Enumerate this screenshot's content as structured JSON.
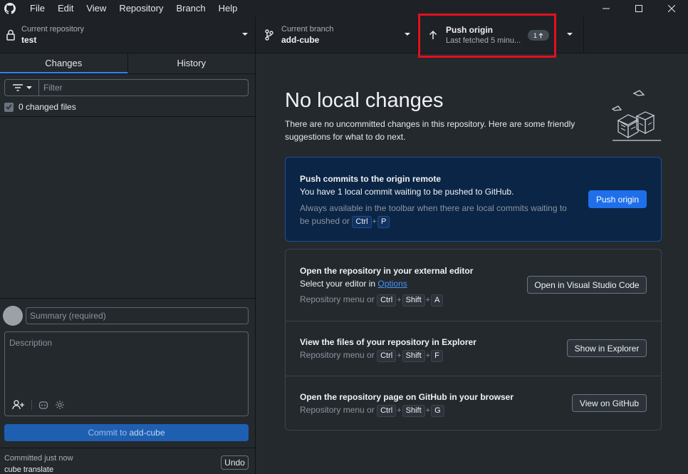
{
  "menu": [
    "File",
    "Edit",
    "View",
    "Repository",
    "Branch",
    "Help"
  ],
  "toolbar": {
    "repo_label": "Current repository",
    "repo_name": "test",
    "branch_label": "Current branch",
    "branch_name": "add-cube",
    "push_title": "Push origin",
    "push_sub": "Last fetched 5 minu...",
    "push_count": "1"
  },
  "sidebar": {
    "tabs": [
      "Changes",
      "History"
    ],
    "filter_placeholder": "Filter",
    "changed_files": "0 changed files",
    "summary_placeholder": "Summary (required)",
    "description_placeholder": "Description",
    "commit_prefix": "Commit to ",
    "commit_branch": "add-cube",
    "last_commit_label": "Committed just now",
    "last_commit_title": "cube translate",
    "undo_label": "Undo"
  },
  "main": {
    "heading": "No local changes",
    "intro": "There are no uncommitted changes in this repository. Here are some friendly suggestions for what to do next.",
    "push_card": {
      "title": "Push commits to the origin remote",
      "body": "You have 1 local commit waiting to be pushed to GitHub.",
      "hint": "Always available in the toolbar when there are local commits waiting to be pushed or",
      "keys": [
        "Ctrl",
        "P"
      ],
      "button": "Push origin"
    },
    "editor_card": {
      "title": "Open the repository in your external editor",
      "body_prefix": "Select your editor in ",
      "body_link": "Options",
      "hint": "Repository menu or",
      "keys": [
        "Ctrl",
        "Shift",
        "A"
      ],
      "button": "Open in Visual Studio Code"
    },
    "explorer_card": {
      "title": "View the files of your repository in Explorer",
      "hint": "Repository menu or",
      "keys": [
        "Ctrl",
        "Shift",
        "F"
      ],
      "button": "Show in Explorer"
    },
    "github_card": {
      "title": "Open the repository page on GitHub in your browser",
      "hint": "Repository menu or",
      "keys": [
        "Ctrl",
        "Shift",
        "G"
      ],
      "button": "View on GitHub"
    }
  },
  "colors": {
    "accent": "#1f6feb",
    "highlight": "#e3101d",
    "background": "#24292e"
  }
}
